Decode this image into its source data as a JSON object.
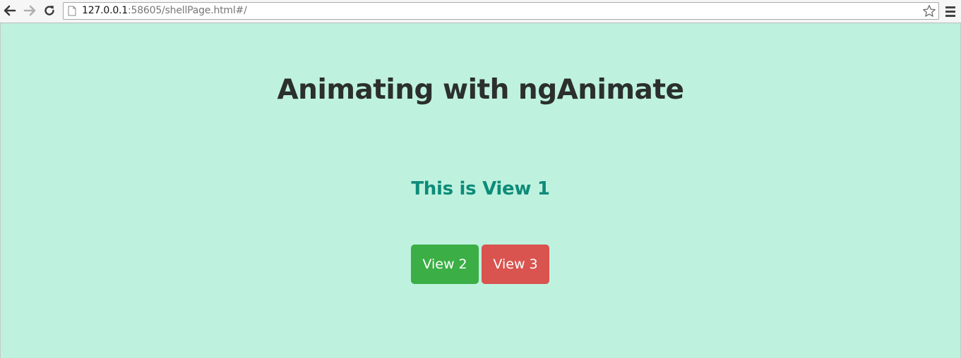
{
  "browser": {
    "url_host": "127.0.0.1",
    "url_rest": ":58605/shellPage.html#/",
    "icons": {
      "back": "arrow-left-icon",
      "forward": "arrow-right-icon",
      "reload": "reload-icon",
      "page": "page-icon",
      "bookmark": "star-icon",
      "menu": "hamburger-menu-icon"
    }
  },
  "page": {
    "title": "Animating with ngAnimate",
    "view_heading": "This is View 1",
    "buttons": [
      {
        "label": "View 2",
        "color": "#3bae45"
      },
      {
        "label": "View 3",
        "color": "#d9534f"
      }
    ],
    "background_color": "#bef2de",
    "heading_color": "#0e8b79"
  }
}
